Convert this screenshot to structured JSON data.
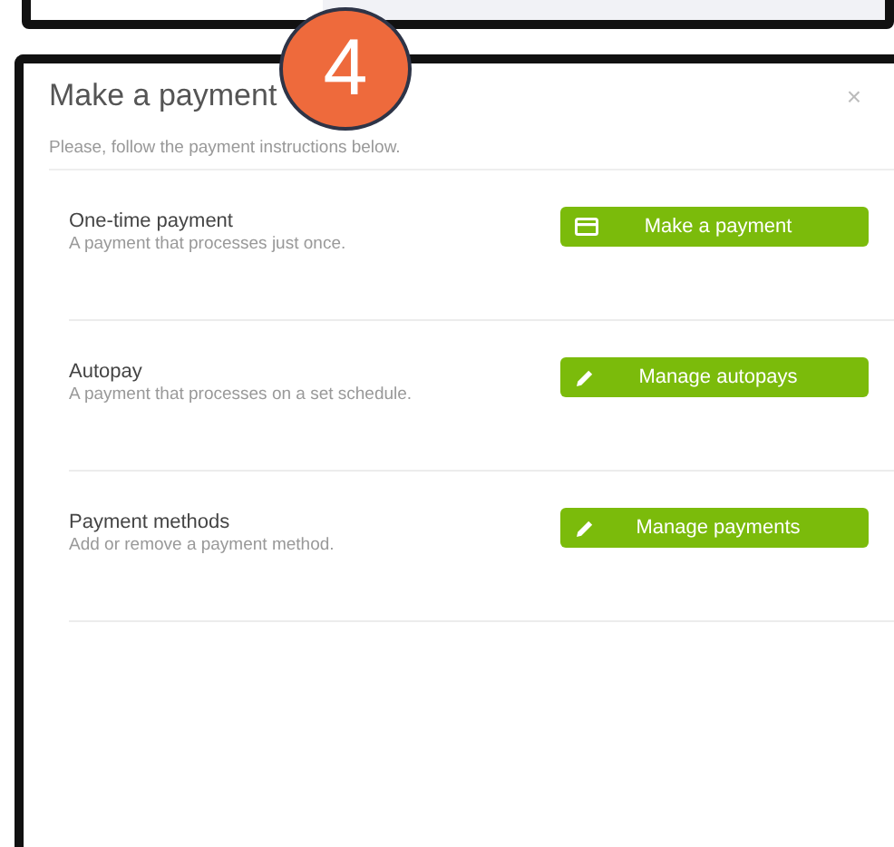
{
  "step_badge": "4",
  "modal": {
    "title": "Make a payment",
    "close": "×",
    "subtitle": "Please, follow the payment instructions below.",
    "sections": [
      {
        "title": "One-time payment",
        "description": "A payment that processes just once.",
        "button": {
          "label": "Make a payment"
        }
      },
      {
        "title": "Autopay",
        "description": "A payment that processes on a set schedule.",
        "button": {
          "label": "Manage autopays"
        }
      },
      {
        "title": "Payment methods",
        "description": "Add or remove a payment method.",
        "button": {
          "label": "Manage payments"
        }
      }
    ]
  }
}
